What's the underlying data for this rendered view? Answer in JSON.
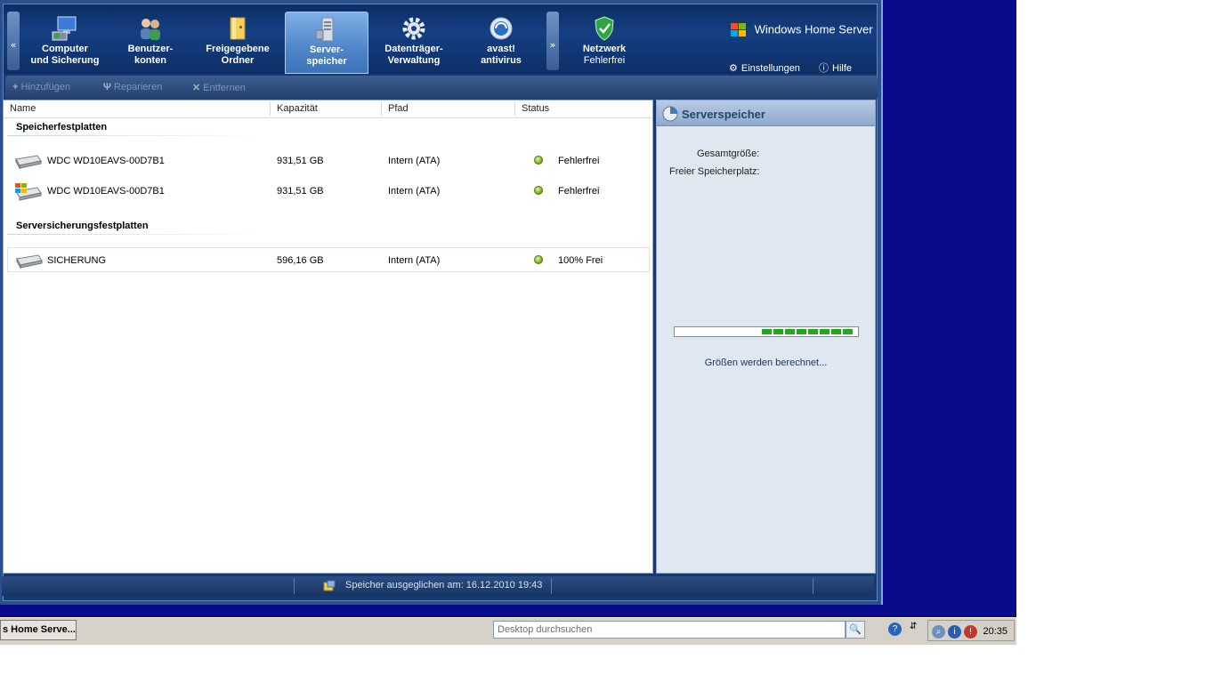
{
  "window": {
    "nav_prev": "«",
    "nav_next": "»",
    "tabs": [
      {
        "line1": "Computer",
        "line2": "und Sicherung",
        "icon": "computer-icon"
      },
      {
        "line1": "Benutzer-",
        "line2": "konten",
        "icon": "users-icon"
      },
      {
        "line1": "Freigegebene",
        "line2": "Ordner",
        "icon": "folder-icon"
      },
      {
        "line1": "Server-",
        "line2": "speicher",
        "icon": "server-icon",
        "active": true
      },
      {
        "line1": "Datenträger-",
        "line2": "Verwaltung",
        "icon": "gear-icon"
      },
      {
        "line1": "avast!",
        "line2": "antivirus",
        "icon": "avast-icon"
      }
    ],
    "network": {
      "title": "Netzwerk",
      "status": "Fehlerfrei",
      "icon": "shield-check-icon"
    },
    "brand": "Windows Home Server",
    "settings_label": "Einstellungen",
    "help_label": "Hilfe"
  },
  "toolbar": {
    "add_label": "Hinzufügen",
    "repair_label": "Reparieren",
    "remove_label": "Entfernen"
  },
  "list": {
    "columns": [
      "Name",
      "Kapazität",
      "Pfad",
      "Status"
    ],
    "groups": [
      {
        "title": "Speicherfestplatten",
        "rows": [
          {
            "name": "WDC WD10EAVS-00D7B1",
            "capacity": "931,51 GB",
            "path": "Intern (ATA)",
            "status": "Fehlerfrei"
          },
          {
            "name": "WDC WD10EAVS-00D7B1",
            "capacity": "931,51 GB",
            "path": "Intern (ATA)",
            "status": "Fehlerfrei"
          }
        ]
      },
      {
        "title": "Serversicherungsfestplatten",
        "rows": [
          {
            "name": "SICHERUNG",
            "capacity": "596,16 GB",
            "path": "Intern (ATA)",
            "status": "100% Frei"
          }
        ]
      }
    ]
  },
  "panel": {
    "title": "Serverspeicher",
    "total_label": "Gesamtgröße:",
    "free_label": "Freier Speicherplatz:",
    "calculating": "Größen werden berechnet..."
  },
  "statusbar": {
    "text": "Speicher ausgeglichen am: 16.12.2010 19:43"
  },
  "taskbar": {
    "task_label": "s Home Serve...",
    "search_placeholder": "Desktop durchsuchen",
    "clock": "20:35"
  },
  "colors": {
    "accent": "#143f82",
    "status_ok": "#6aa514",
    "desktop": "#0a0a8a",
    "progress": "#1daa1d"
  }
}
